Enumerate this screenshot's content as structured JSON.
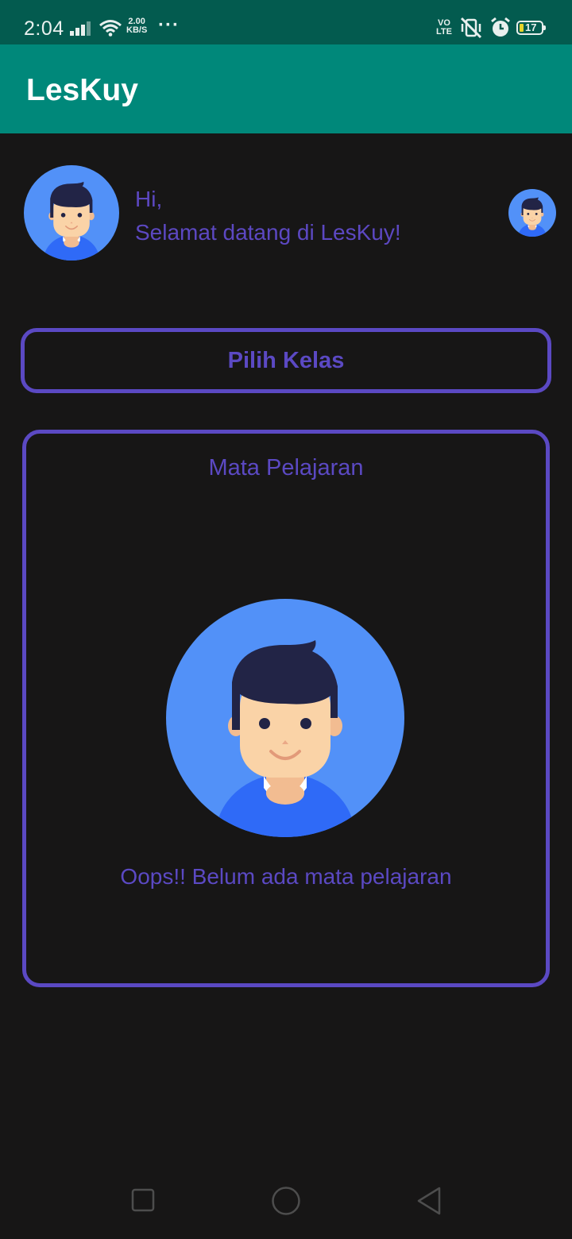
{
  "status_bar": {
    "time": "2:04",
    "speed_value": "2.00",
    "speed_unit": "KB/S",
    "more": "···",
    "volte_top": "VO",
    "volte_bottom": "LTE",
    "battery": "17",
    "icons": [
      "signal-icon",
      "wifi-icon",
      "mute-vibrate-icon",
      "alarm-icon",
      "battery-icon"
    ]
  },
  "app_bar": {
    "title": "LesKuy"
  },
  "greeting": {
    "line1": "Hi,",
    "line2": "Selamat datang di LesKuy!"
  },
  "choose_class": {
    "label": "Pilih Kelas"
  },
  "subjects": {
    "title": "Mata Pelajaran",
    "empty_message": "Oops!! Belum ada mata pelajaran"
  },
  "nav_bar": {
    "icons": [
      "recents-icon",
      "home-icon",
      "back-icon"
    ]
  },
  "colors": {
    "status_bar": "#035B4F",
    "app_bar": "#00887A",
    "background": "#171616",
    "accent": "#5B49C3",
    "avatar_bg": "#5291F8"
  }
}
